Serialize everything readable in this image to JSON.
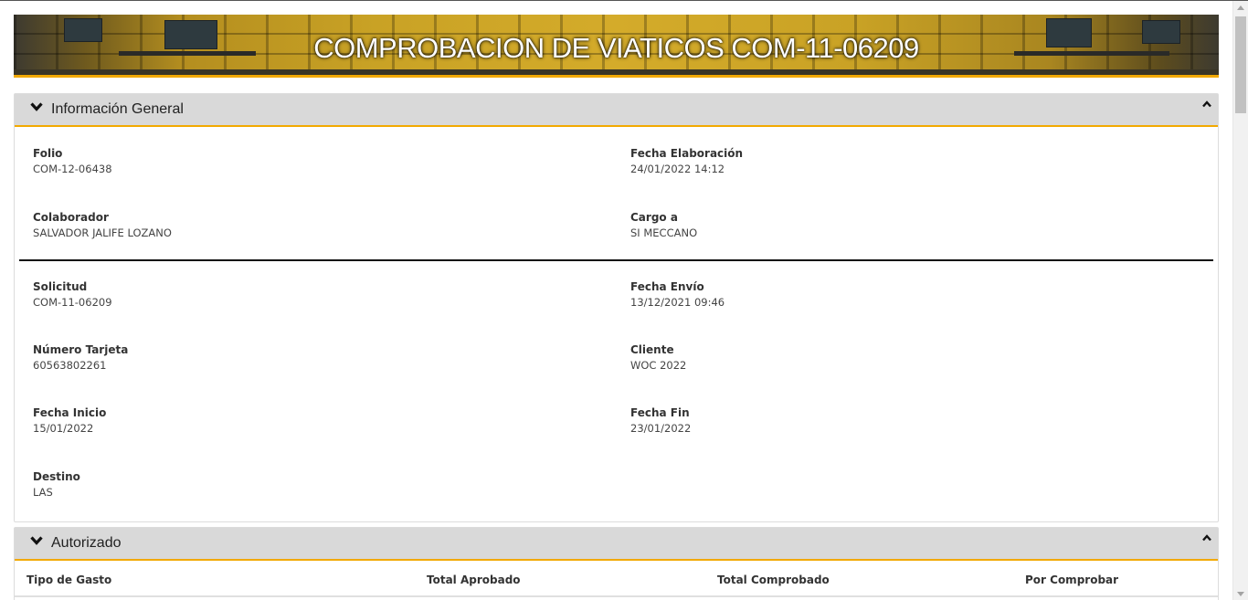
{
  "banner": {
    "title": "COMPROBACION DE VIATICOS COM-11-06209"
  },
  "general": {
    "title": "Información General",
    "header_icon": "chevron-down-icon",
    "collapse_icon": "chevron-up-icon",
    "fields": {
      "folio": {
        "label": "Folio",
        "value": "COM-12-06438"
      },
      "fecha_elaboracion": {
        "label": "Fecha Elaboración",
        "value": "24/01/2022 14:12"
      },
      "colaborador": {
        "label": "Colaborador",
        "value": "SALVADOR JALIFE LOZANO"
      },
      "cargo_a": {
        "label": "Cargo a",
        "value": "SI MECCANO"
      },
      "solicitud": {
        "label": "Solicitud",
        "value": "COM-11-06209"
      },
      "fecha_envio": {
        "label": "Fecha Envío",
        "value": "13/12/2021 09:46"
      },
      "numero_tarjeta": {
        "label": "Número Tarjeta",
        "value": "60563802261"
      },
      "cliente": {
        "label": "Cliente",
        "value": "WOC 2022"
      },
      "fecha_inicio": {
        "label": "Fecha Inicio",
        "value": "15/01/2022"
      },
      "fecha_fin": {
        "label": "Fecha Fin",
        "value": "23/01/2022"
      },
      "destino": {
        "label": "Destino",
        "value": "LAS"
      }
    }
  },
  "autorizado": {
    "title": "Autorizado",
    "header_icon": "chevron-down-icon",
    "collapse_icon": "chevron-up-icon",
    "columns": [
      "Tipo de Gasto",
      "Total Aprobado",
      "Total Comprobado",
      "Por Comprobar"
    ]
  },
  "colors": {
    "accent": "#f2a900",
    "panel_header_bg": "#d9d9d9"
  }
}
